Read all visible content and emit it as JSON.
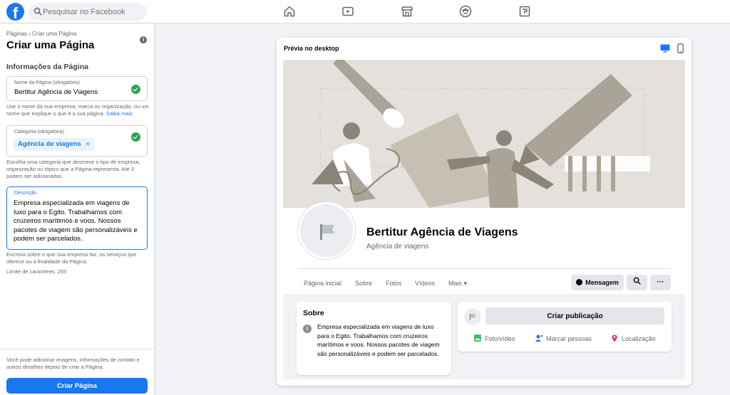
{
  "topbar": {
    "logo": "f",
    "search_placeholder": "Pesquisar no Facebook",
    "nav_icons": [
      "home-icon",
      "watch-icon",
      "marketplace-icon",
      "groups-icon",
      "gaming-icon"
    ]
  },
  "left_panel": {
    "breadcrumb": "Páginas › Criar uma Página",
    "title": "Criar uma Página",
    "section_title": "Informações da Página",
    "name_field": {
      "label": "Nome da Página (obrigatório)",
      "value": "Bertitur Agência de Viagens"
    },
    "name_helper": "Use o nome da sua empresa, marca ou organização, ou um nome que explique o que é a sua página.",
    "name_helper_link": "Saiba mais",
    "category_field": {
      "label": "Categoria (obrigatória)",
      "chip": "Agência de viagens",
      "chip_remove": "×"
    },
    "category_helper": "Escolha uma categoria que descreve o tipo de empresa, organização ou tópico que a Página representa. Até 3 podem ser adicionadas.",
    "description_field": {
      "label": "Descrição",
      "value": "Empresa especializada em viagens de luxo para o Egito. Trabalhamos com cruzeiros marítimos e voos. Nossos pacotes de viagem são personalizáveis e podem ser parcelados."
    },
    "description_helper": "Escreva sobre o que sua empresa faz, os serviços que oferece ou a finalidade da Página.",
    "char_limit": "Limite de caracteres: 255",
    "footer_note": "Você pode adicionar imagens, informações de contato e outros detalhes depois de criar a Página.",
    "create_button": "Criar Página"
  },
  "preview": {
    "title": "Prévia no desktop",
    "page_name": "Bertitur Agência de Viagens",
    "page_category": "Agência de viagens",
    "tabs": [
      "Página inicial",
      "Sobre",
      "Fotos",
      "Vídeos",
      "Mais ▾"
    ],
    "message_button": "Mensagem",
    "more_button": "···",
    "about": {
      "title": "Sobre",
      "text": "Empresa especializada em viagens de luxo para o Egito. Trabalhamos com cruzeiros marítimos e voos. Nossos pacotes de viagem são personalizáveis e podem ser parcelados."
    },
    "create_post": "Criar publicação",
    "post_actions": [
      "Foto/vídeo",
      "Marcar pessoas",
      "Localização"
    ]
  },
  "colors": {
    "brand": "#1877f2",
    "success": "#31a24c",
    "cover_background": "#e4e1dc"
  }
}
